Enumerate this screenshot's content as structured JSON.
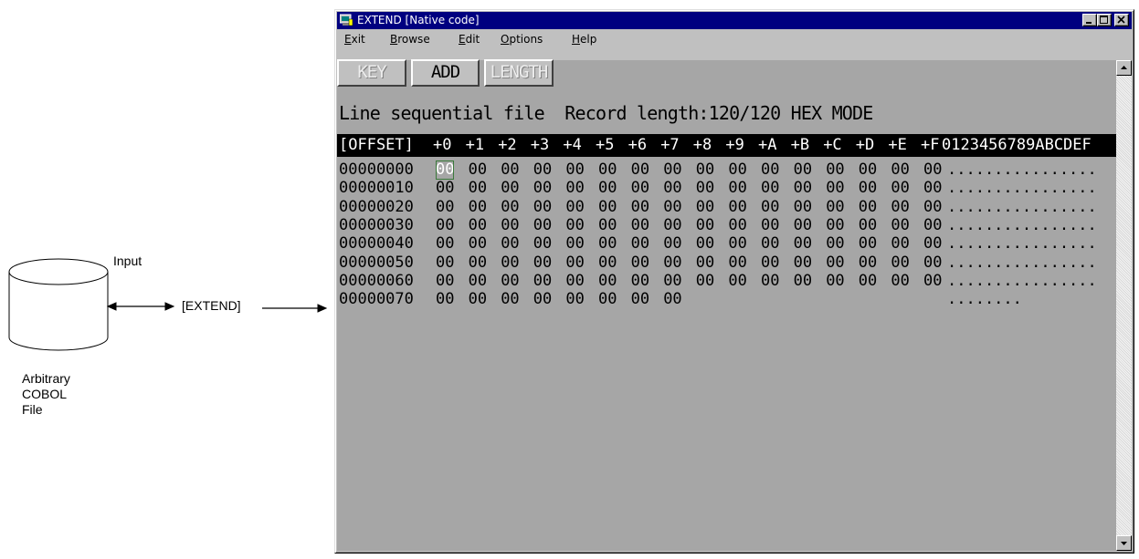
{
  "diagram": {
    "input_label": "Input",
    "extend_label": "[EXTEND]",
    "file_label": "Arbitrary\nCOBOL\nFile"
  },
  "window": {
    "title": "EXTEND [Native code]",
    "menu": [
      {
        "label": "Exit",
        "accel": "E",
        "rest": "xit"
      },
      {
        "label": "Browse",
        "accel": "B",
        "rest": "rowse"
      },
      {
        "label": "Edit",
        "accel": "E",
        "rest": "dit"
      },
      {
        "label": "Options",
        "accel": "O",
        "rest": "ptions"
      },
      {
        "label": "Help",
        "accel": "H",
        "rest": "elp"
      }
    ],
    "toolbar": {
      "key_label": "KEY",
      "add_label": "ADD",
      "length_label": "LENGTH"
    },
    "status_line": "Line sequential file  Record length:120/120 HEX MODE",
    "hex_header": {
      "offset_label": "[OFFSET]",
      "columns": [
        "+0",
        "+1",
        "+2",
        "+3",
        "+4",
        "+5",
        "+6",
        "+7",
        "+8",
        "+9",
        "+A",
        "+B",
        "+C",
        "+D",
        "+E",
        "+F"
      ],
      "ascii_label": "0123456789ABCDEF"
    },
    "rows": [
      {
        "offset": "00000000",
        "bytes": [
          "00",
          "00",
          "00",
          "00",
          "00",
          "00",
          "00",
          "00",
          "00",
          "00",
          "00",
          "00",
          "00",
          "00",
          "00",
          "00"
        ],
        "ascii": "................"
      },
      {
        "offset": "00000010",
        "bytes": [
          "00",
          "00",
          "00",
          "00",
          "00",
          "00",
          "00",
          "00",
          "00",
          "00",
          "00",
          "00",
          "00",
          "00",
          "00",
          "00"
        ],
        "ascii": "................"
      },
      {
        "offset": "00000020",
        "bytes": [
          "00",
          "00",
          "00",
          "00",
          "00",
          "00",
          "00",
          "00",
          "00",
          "00",
          "00",
          "00",
          "00",
          "00",
          "00",
          "00"
        ],
        "ascii": "................"
      },
      {
        "offset": "00000030",
        "bytes": [
          "00",
          "00",
          "00",
          "00",
          "00",
          "00",
          "00",
          "00",
          "00",
          "00",
          "00",
          "00",
          "00",
          "00",
          "00",
          "00"
        ],
        "ascii": "................"
      },
      {
        "offset": "00000040",
        "bytes": [
          "00",
          "00",
          "00",
          "00",
          "00",
          "00",
          "00",
          "00",
          "00",
          "00",
          "00",
          "00",
          "00",
          "00",
          "00",
          "00"
        ],
        "ascii": "................"
      },
      {
        "offset": "00000050",
        "bytes": [
          "00",
          "00",
          "00",
          "00",
          "00",
          "00",
          "00",
          "00",
          "00",
          "00",
          "00",
          "00",
          "00",
          "00",
          "00",
          "00"
        ],
        "ascii": "................"
      },
      {
        "offset": "00000060",
        "bytes": [
          "00",
          "00",
          "00",
          "00",
          "00",
          "00",
          "00",
          "00",
          "00",
          "00",
          "00",
          "00",
          "00",
          "00",
          "00",
          "00"
        ],
        "ascii": "................"
      },
      {
        "offset": "00000070",
        "bytes": [
          "00",
          "00",
          "00",
          "00",
          "00",
          "00",
          "00",
          "00"
        ],
        "ascii": "........"
      }
    ],
    "icons": {
      "app": "extend-app-icon",
      "minimize": "minimize-icon",
      "maximize": "maximize-icon",
      "close": "close-icon",
      "scroll_up": "scroll-up-arrow-icon",
      "scroll_down": "scroll-down-arrow-icon"
    },
    "colors": {
      "titlebar": "#000080",
      "content_bg": "#a6a6a6",
      "header_bg": "#000000"
    }
  }
}
